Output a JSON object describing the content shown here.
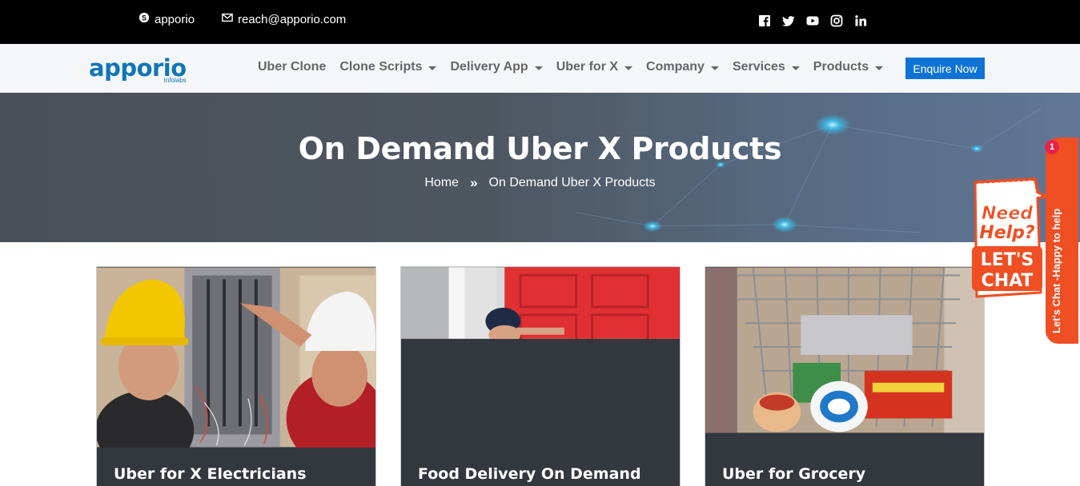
{
  "topbar": {
    "skype": "apporio",
    "email": "reach@apporio.com",
    "socials": [
      "facebook-icon",
      "twitter-icon",
      "youtube-icon",
      "instagram-icon",
      "linkedin-icon"
    ]
  },
  "logo": {
    "main": "apporio",
    "sub": "Infolabs"
  },
  "nav": {
    "items": [
      {
        "label": "Uber Clone",
        "dropdown": false
      },
      {
        "label": "Clone Scripts",
        "dropdown": true
      },
      {
        "label": "Delivery App",
        "dropdown": true
      },
      {
        "label": "Uber for X",
        "dropdown": true
      },
      {
        "label": "Company",
        "dropdown": true
      },
      {
        "label": "Services",
        "dropdown": true
      },
      {
        "label": "Products",
        "dropdown": true
      }
    ],
    "cta": "Enquire Now"
  },
  "hero": {
    "title": "On Demand Uber X Products",
    "breadcrumb": {
      "home": "Home",
      "separator": "»",
      "current": "On Demand Uber X Products"
    }
  },
  "cards": [
    {
      "title": "Uber for X Electricians"
    },
    {
      "title": "Food Delivery On Demand"
    },
    {
      "title": "Uber for Grocery"
    }
  ],
  "chat": {
    "badge": "1",
    "tab_text": "Let's Chat -Happy to help",
    "bubble_line1": "Need",
    "bubble_line2": "Help?",
    "bubble_line3": "LET'S",
    "bubble_line4": "CHAT"
  },
  "colors": {
    "accent": "#0e73d6",
    "brand": "#1176b8",
    "chat": "#f04e23"
  }
}
